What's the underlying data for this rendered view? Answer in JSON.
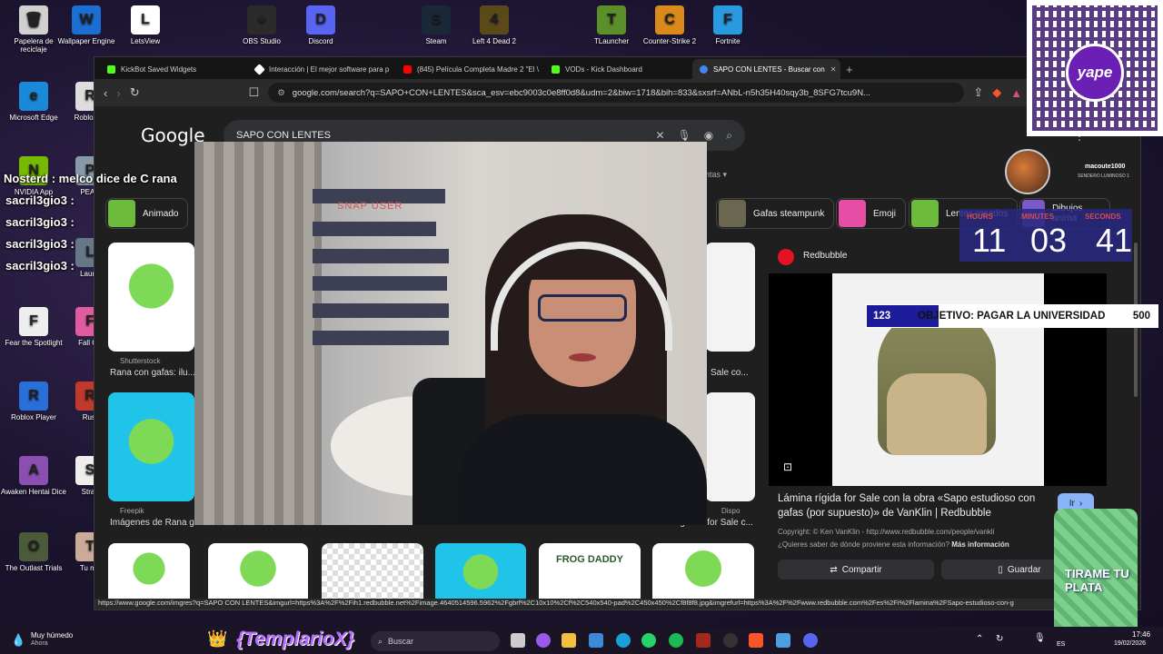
{
  "desktop": {
    "icons": [
      {
        "label": "Papelera de reciclaje",
        "color": "#d0d0d0",
        "glyph": "🗑"
      },
      {
        "label": "Wallpaper Engine",
        "color": "#1a6fd1",
        "glyph": "W"
      },
      {
        "label": "LetsView",
        "color": "#ffffff",
        "glyph": "L"
      },
      {
        "label": "OBS Studio",
        "color": "#2b2b2b",
        "glyph": "●"
      },
      {
        "label": "Discord",
        "color": "#5865f2",
        "glyph": "D"
      },
      {
        "label": "Steam",
        "color": "#1b2838",
        "glyph": "S"
      },
      {
        "label": "Left 4 Dead 2",
        "color": "#5a4a1a",
        "glyph": "4"
      },
      {
        "label": "TLauncher",
        "color": "#5a8f2a",
        "glyph": "T"
      },
      {
        "label": "Counter-Strike 2",
        "color": "#d98a1a",
        "glyph": "C"
      },
      {
        "label": "Fortnite",
        "color": "#2a9ae0",
        "glyph": "F"
      },
      {
        "label": "Microsoft Edge",
        "color": "#1a8ad8",
        "glyph": "e"
      },
      {
        "label": "Roblox St",
        "color": "#dddddd",
        "glyph": "R"
      },
      {
        "label": "NVIDIA App",
        "color": "#76b900",
        "glyph": "N"
      },
      {
        "label": "PEAK",
        "color": "#8899aa",
        "glyph": "P"
      },
      {
        "label": "Fear the Spotlight",
        "color": "#eeeeee",
        "glyph": "F"
      },
      {
        "label": "Fall Gu",
        "color": "#e05aa0",
        "glyph": "F"
      },
      {
        "label": "Roblox Player",
        "color": "#2a6fd8",
        "glyph": "R"
      },
      {
        "label": "Rust",
        "color": "#c0392b",
        "glyph": "R"
      },
      {
        "label": "Awaken Hentai Dice",
        "color": "#8a4fb0",
        "glyph": "A"
      },
      {
        "label": "Stray",
        "color": "#eeeeee",
        "glyph": "S"
      },
      {
        "label": "The Outlast Trials",
        "color": "#4a5a3a",
        "glyph": "O"
      },
      {
        "label": "Tu ma",
        "color": "#ccaa99",
        "glyph": "T"
      },
      {
        "label": "Launc",
        "color": "#667788",
        "glyph": "L"
      }
    ]
  },
  "browser": {
    "tabs": [
      {
        "label": "KickBot Saved Widgets",
        "color": "#53fc18"
      },
      {
        "label": "Interacción | El mejor software para p",
        "color": "#ffffff"
      },
      {
        "label": "(845) Película Completa Madre 2 \"El \\",
        "color": "#ff0000"
      },
      {
        "label": "VODs - Kick Dashboard",
        "color": "#53fc18"
      },
      {
        "label": "SAPO CON LENTES - Buscar con",
        "color": "#4285f4"
      }
    ],
    "new_tab": "+",
    "url": "google.com/search?q=SAPO+CON+LENTES&sca_esv=ebc9003c0e8ff0d8&udm=2&biw=1718&bih=833&sxsrf=ANbL-n5h35H40sqy3b_8SFG7tcu9N...",
    "nav": {
      "back": "‹",
      "forward": "›",
      "reload": "↻"
    }
  },
  "google": {
    "logo": "Google",
    "query": "SAPO CON LENTES",
    "filter_label": "ientas",
    "chips": [
      "Animado",
      "Gafas steampunk",
      "Emoji",
      "Lentes rosados",
      "Dibujos anima"
    ],
    "results": [
      {
        "source": "Shutterstock",
        "caption": "Rana con gafas: ilu..."
      },
      {
        "source": "Freepik",
        "caption": "Imágenes de Rana g..."
      },
      {
        "source": "Dispo",
        "caption": "Pegatina for Sale c..."
      }
    ],
    "side_caption": "Sale co...",
    "bottom_row_text": "FROG DADDY",
    "panel": {
      "site": "Redbubble",
      "title": "Lámina rígida for Sale con la obra «Sapo estudioso con gafas (por supuesto)» de VanKlin | Redbubble",
      "copyright": "Copyright: © Ken VanKlin - http://www.redbubble.com/people/vankli",
      "info_prefix": "¿Quieres saber de dónde proviene esta información?",
      "info_link": "Más información",
      "go": "Ir",
      "share": "Compartir",
      "save": "Guardar"
    },
    "status_url": "https://www.google.com/imgres?q=SAPO CON LENTES&imgurl=https%3A%2F%2Fih1.redbubble.net%2Fimage.4640514596.5962%2Fgbrf%2C10x10%2Cf%2C540x540-pad%2C450x450%2Cf8f8f8.jpg&imgrefurl=https%3A%2F%2Fwww.redbubble.com%2Fes%2Fi%2Flamina%2FSapo-estudioso-con-g"
  },
  "stream": {
    "webcam_text": "SNAP USER",
    "chat": [
      {
        "text": "Nosterd : melco dice de C rana"
      },
      {
        "text": "sacril3gio3 :"
      },
      {
        "text": "sacril3gio3 :"
      },
      {
        "text": "sacril3gio3 :"
      },
      {
        "text": "sacril3gio3 :"
      }
    ],
    "viewer": {
      "name": "macoute1000",
      "sub": "SENDERO LUMINOSO 1"
    },
    "timer": {
      "hours_label": "HOURS",
      "minutes_label": "MINUTES",
      "seconds_label": "SECONDS",
      "hours": "11",
      "minutes": "03",
      "seconds": "41"
    },
    "goal": {
      "current": "123",
      "label": "OBJETIVO: PAGAR LA UNIVERSIDAD",
      "target": "500",
      "progress": 0.246
    },
    "yape": "yape",
    "cup_text": "TIRAME TU PLATA",
    "templario": "{TemplarioX}"
  },
  "taskbar": {
    "weather": "Muy húmedo",
    "weather_sub": "Ahora",
    "search": "Buscar",
    "lang": "ES",
    "time": "17:46",
    "date": "19/02/2026"
  },
  "colors": {
    "accent": "#8ab4f8",
    "kick": "#53fc18",
    "timer_bg": "#28288a",
    "goal_fill": "#1c1c9a"
  }
}
